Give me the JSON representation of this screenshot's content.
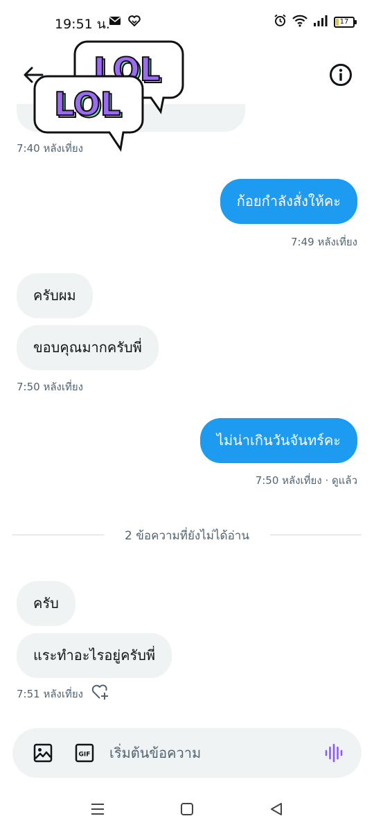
{
  "status_bar": {
    "time": "19:51 น.",
    "battery": "17"
  },
  "header": {
    "sticker_text": "LOL"
  },
  "messages": {
    "ts_1": "7:40 หลังเที่ยง",
    "out_1": "ก้อยกำลังสั่งให้คะ",
    "ts_2": "7:49 หลังเที่ยง",
    "in_1": "ครับผม",
    "in_2": "ขอบคุณมากครับพี่",
    "ts_3": "7:50 หลังเที่ยง",
    "out_2": "ไม่น่าเกินวันจันทร์คะ",
    "ts_4": "7:50 หลังเที่ยง · ดูแล้ว",
    "unread_divider": "2 ข้อความที่ยังไม่ได้อ่าน",
    "in_3": "ครับ",
    "in_4": "แระทำอะไรอยู่ครับพี่",
    "ts_5": "7:51 หลังเที่ยง"
  },
  "composer": {
    "placeholder": "เริ่มต้นข้อความ",
    "gif_label": "GIF"
  },
  "colors": {
    "accent": "#1d9bf0",
    "incoming_bubble": "#eff3f4",
    "sticker_purple": "#9b6bf2",
    "sticker_green": "#7be2b5",
    "voice": "#8a5cf6"
  }
}
